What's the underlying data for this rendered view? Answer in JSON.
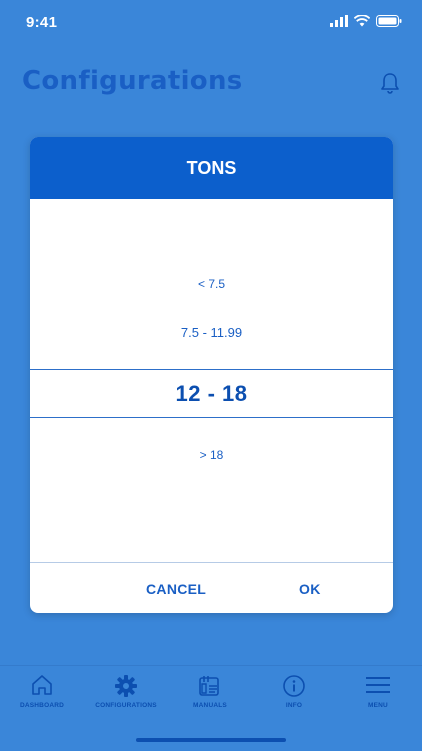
{
  "status": {
    "time": "9:41",
    "icons": [
      "cellular-signal-icon",
      "wifi-icon",
      "battery-icon"
    ]
  },
  "header": {
    "title": "Configurations",
    "icon": "bell-icon"
  },
  "dialog": {
    "title": "TONS",
    "options": [
      "< 7.5",
      "7.5 - 11.99",
      "12 - 18",
      "> 18"
    ],
    "selected": "12 - 18",
    "cancel_label": "CANCEL",
    "ok_label": "OK"
  },
  "tabs": [
    {
      "label": "DASHBOARD",
      "icon": "home-icon"
    },
    {
      "label": "CONFIGURATIONS",
      "icon": "gear-icon",
      "active": true
    },
    {
      "label": "MANUALS",
      "icon": "manuals-icon"
    },
    {
      "label": "INFO",
      "icon": "info-icon"
    },
    {
      "label": "MENU",
      "icon": "hamburger-menu-icon"
    }
  ],
  "colors": {
    "background": "#3a86d9",
    "primary": "#0c5fcc",
    "text_accent": "#1a5fc4",
    "dialog_bg": "#ffffff"
  }
}
